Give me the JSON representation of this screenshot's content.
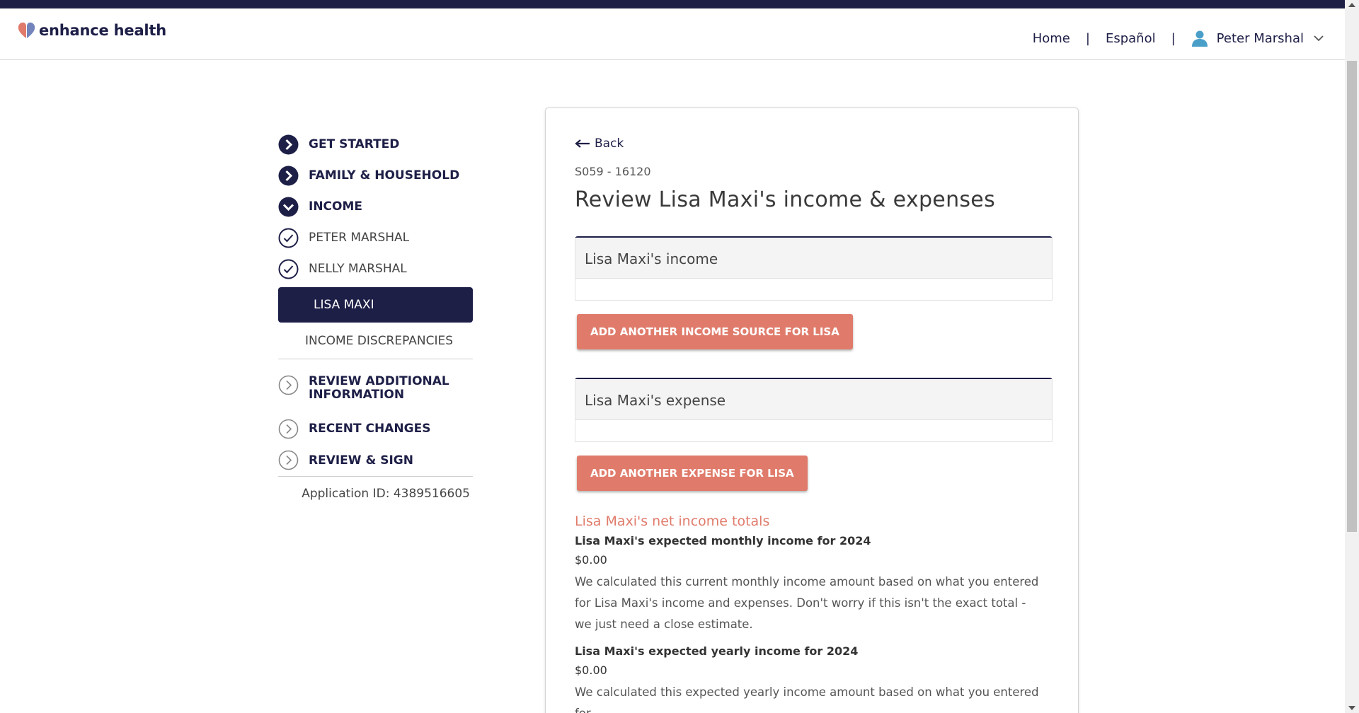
{
  "header": {
    "logo_text": "enhance health",
    "nav_home": "Home",
    "nav_sep": "|",
    "nav_lang": "Español",
    "user_name": "Peter Marshal"
  },
  "sidebar": {
    "steps": [
      {
        "label": "GET STARTED"
      },
      {
        "label": "FAMILY & HOUSEHOLD"
      },
      {
        "label": "INCOME"
      },
      {
        "label": "PETER MARSHAL"
      },
      {
        "label": "NELLY MARSHAL"
      },
      {
        "label": "LISA MAXI"
      },
      {
        "label": "INCOME DISCREPANCIES"
      },
      {
        "label": "REVIEW ADDITIONAL INFORMATION"
      },
      {
        "label": "RECENT CHANGES"
      },
      {
        "label": "REVIEW & SIGN"
      }
    ],
    "application_id": "Application ID: 4389516605"
  },
  "main": {
    "back_label": "Back",
    "app_code": "S059 - 16120",
    "title": "Review Lisa Maxi's income & expenses",
    "income_panel_title": "Lisa Maxi's income",
    "add_income_button": "ADD ANOTHER INCOME SOURCE FOR LISA",
    "expense_panel_title": "Lisa Maxi's expense",
    "add_expense_button": "ADD ANOTHER EXPENSE FOR LISA",
    "totals_title": "Lisa Maxi's net income totals",
    "monthly_label": "Lisa Maxi's expected monthly income for 2024",
    "monthly_amount": "$0.00",
    "monthly_note": "We calculated this current monthly income amount based on what you entered for Lisa Maxi's income and expenses. Don't worry if this isn't the exact total - we just need a close estimate.",
    "yearly_label": "Lisa Maxi's expected yearly income for 2024",
    "yearly_amount": "$0.00",
    "yearly_note": "We calculated this expected yearly income amount based on what you entered for"
  },
  "colors": {
    "navy": "#1e1f47",
    "coral": "#e07b6b"
  }
}
